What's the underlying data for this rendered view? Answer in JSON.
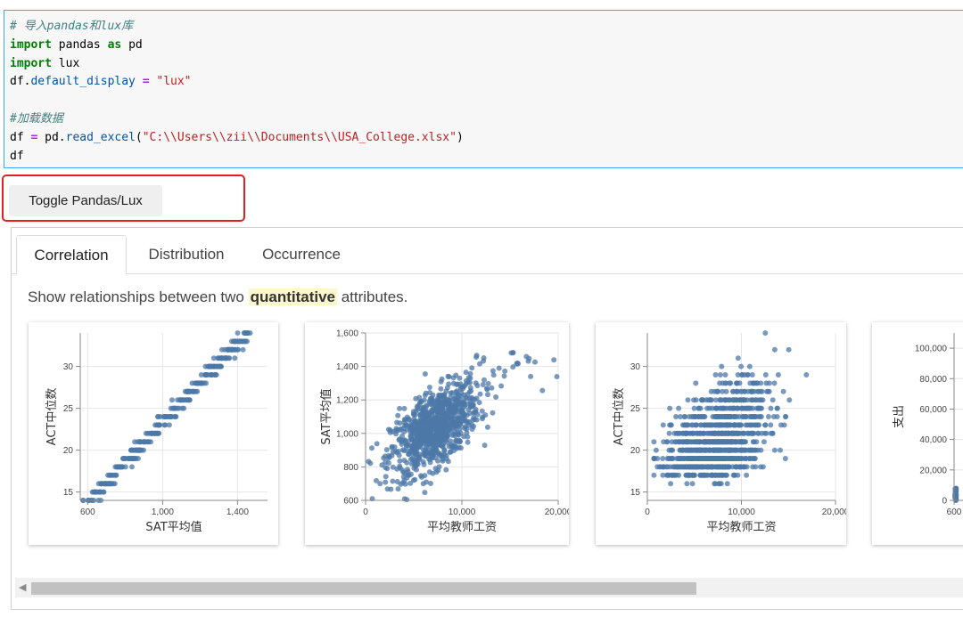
{
  "code_cell": {
    "lines": [
      [
        {
          "t": "cm",
          "v": "# 导入pandas和lux库"
        }
      ],
      [
        {
          "t": "kw",
          "v": "import"
        },
        {
          "t": "",
          "v": " pandas "
        },
        {
          "t": "kw",
          "v": "as"
        },
        {
          "t": "",
          "v": " pd"
        }
      ],
      [
        {
          "t": "kw",
          "v": "import"
        },
        {
          "t": "",
          "v": " lux"
        }
      ],
      [
        {
          "t": "",
          "v": "df."
        },
        {
          "t": "at",
          "v": "default_display"
        },
        {
          "t": "",
          "v": " "
        },
        {
          "t": "op",
          "v": "="
        },
        {
          "t": "",
          "v": " "
        },
        {
          "t": "st",
          "v": "\"lux\""
        }
      ],
      [
        {
          "t": "",
          "v": ""
        }
      ],
      [
        {
          "t": "cm",
          "v": "#加载数据"
        }
      ],
      [
        {
          "t": "",
          "v": "df "
        },
        {
          "t": "op",
          "v": "="
        },
        {
          "t": "",
          "v": " pd."
        },
        {
          "t": "at",
          "v": "read_excel"
        },
        {
          "t": "",
          "v": "("
        },
        {
          "t": "st",
          "v": "\"C:\\\\Users\\\\zii\\\\Documents\\\\USA_College.xlsx\""
        },
        {
          "t": "",
          "v": ")"
        }
      ],
      [
        {
          "t": "",
          "v": "df"
        }
      ]
    ]
  },
  "toggle_button": {
    "label": "Toggle Pandas/Lux"
  },
  "tabs": [
    {
      "label": "Correlation",
      "active": true
    },
    {
      "label": "Distribution",
      "active": false
    },
    {
      "label": "Occurrence",
      "active": false
    }
  ],
  "description": {
    "before": "Show relationships between two ",
    "highlight": "quantitative",
    "after": " attributes."
  },
  "colors": {
    "point": "#4c78a8",
    "accent_border": "#42a5f5",
    "highlight_box": "#e02020"
  },
  "chart_data": [
    {
      "type": "scatter",
      "xlabel": "SAT平均值",
      "ylabel": "ACT中位数",
      "xlim": [
        560,
        1560
      ],
      "ylim": [
        14,
        34
      ],
      "xticks": [
        600,
        1000,
        1400
      ],
      "xtick_labels": [
        "600",
        "1,000",
        "1,400"
      ],
      "yticks": [
        15,
        20,
        25,
        30
      ],
      "ytick_labels": [
        "15",
        "20",
        "25",
        "30"
      ],
      "pattern": "act_sat"
    },
    {
      "type": "scatter",
      "xlabel": "平均教师工资",
      "ylabel": "SAT平均值",
      "xlim": [
        0,
        20000
      ],
      "ylim": [
        600,
        1600
      ],
      "xticks": [
        0,
        10000,
        20000
      ],
      "xtick_labels": [
        "0",
        "10,000",
        "20,000"
      ],
      "yticks": [
        600,
        800,
        1000,
        1200,
        1400,
        1600
      ],
      "ytick_labels": [
        "600",
        "800",
        "1,000",
        "1,200",
        "1,400",
        "1,600"
      ],
      "pattern": "sat_salary"
    },
    {
      "type": "scatter",
      "xlabel": "平均教师工资",
      "ylabel": "ACT中位数",
      "xlim": [
        0,
        20000
      ],
      "ylim": [
        14,
        34
      ],
      "xticks": [
        0,
        10000,
        20000
      ],
      "xtick_labels": [
        "0",
        "10,000",
        "20,000"
      ],
      "yticks": [
        15,
        20,
        25,
        30
      ],
      "ytick_labels": [
        "15",
        "20",
        "25",
        "30"
      ],
      "pattern": "act_salary"
    },
    {
      "type": "scatter",
      "xlabel": "",
      "ylabel": "支出",
      "xlim": [
        600,
        1600
      ],
      "ylim": [
        0,
        110000
      ],
      "xticks": [
        600
      ],
      "xtick_labels": [
        "600"
      ],
      "yticks": [
        0,
        20000,
        40000,
        60000,
        80000,
        100000
      ],
      "ytick_labels": [
        "0",
        "20,000",
        "40,000",
        "60,000",
        "80,000",
        "100,000"
      ],
      "pattern": "spend"
    }
  ]
}
